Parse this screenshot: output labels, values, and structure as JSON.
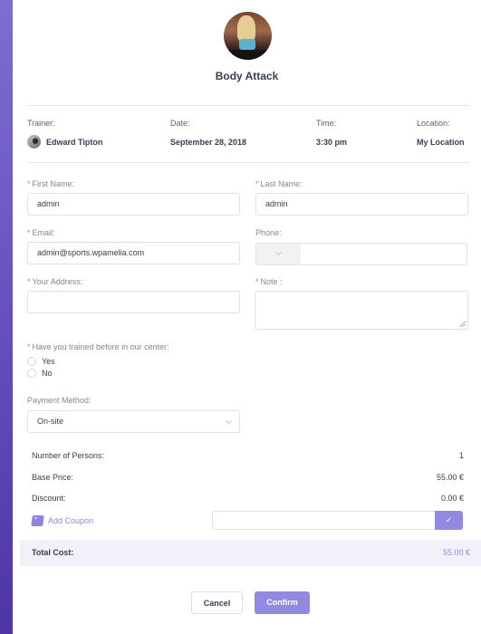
{
  "event": {
    "title": "Body Attack",
    "image": "body-attack-class-photo"
  },
  "info": {
    "trainer_label": "Trainer:",
    "trainer_value": "Edward Tipton",
    "date_label": "Date:",
    "date_value": "September 28, 2018",
    "time_label": "Time:",
    "time_value": "3:30 pm",
    "location_label": "Location:",
    "location_value": "My Location"
  },
  "form": {
    "required_mark": "*",
    "first_name": {
      "label": "First Name:",
      "value": "admin",
      "required": true
    },
    "last_name": {
      "label": "Last Name:",
      "value": "admin",
      "required": true
    },
    "email": {
      "label": "Email:",
      "value": "admin@sports.wpamelia.com",
      "required": true
    },
    "phone": {
      "label": "Phone:",
      "value": "",
      "country_code": ""
    },
    "address": {
      "label": "Your Address:",
      "value": "",
      "required": true
    },
    "note": {
      "label": "Note :",
      "value": "",
      "required": true
    },
    "trained_before": {
      "label": "Have you trained before in our center:",
      "required": true,
      "options": [
        "Yes",
        "No"
      ],
      "selected": null
    },
    "payment_method": {
      "label": "Payment Method:",
      "selected": "On-site"
    }
  },
  "summary": {
    "persons_label": "Number of Persons:",
    "persons_value": "1",
    "base_price_label": "Base Price:",
    "base_price_value": "55.00 €",
    "discount_label": "Discount:",
    "discount_value": "0.00 €",
    "coupon_label": "Add Coupon",
    "coupon_value": "",
    "coupon_submit": "✓",
    "total_label": "Total Cost:",
    "total_value": "55.00 €"
  },
  "actions": {
    "cancel": "Cancel",
    "confirm": "Confirm"
  },
  "colors": {
    "accent": "#918ae0",
    "required": "#f2736e",
    "total_band": "#f2f1fa"
  }
}
